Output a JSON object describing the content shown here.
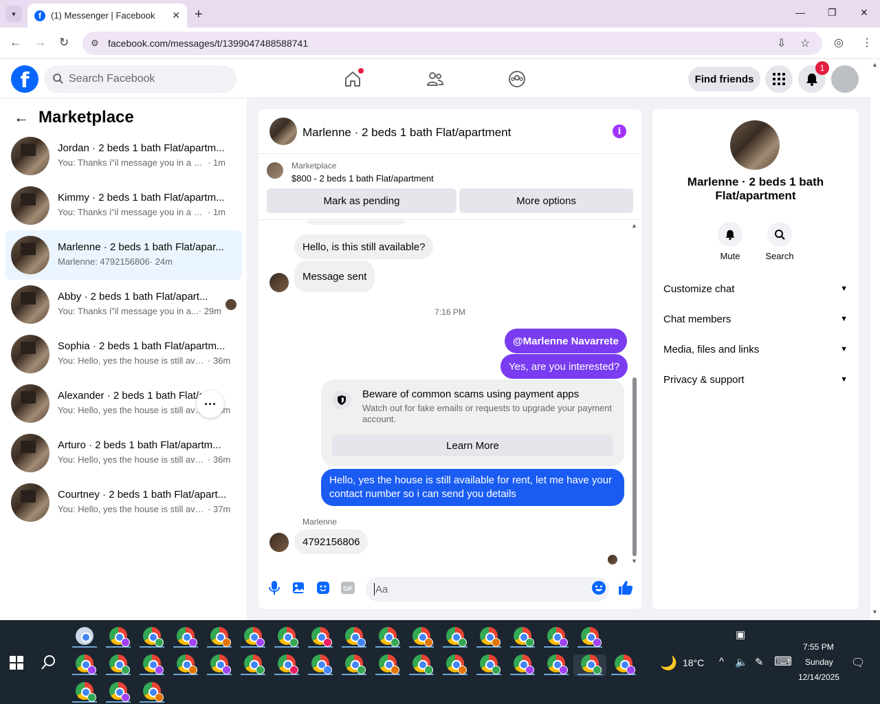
{
  "browser": {
    "tab_title": "(1) Messenger | Facebook",
    "url": "facebook.com/messages/t/1399047488588741"
  },
  "fb_header": {
    "search_placeholder": "Search Facebook",
    "find_friends": "Find friends",
    "notification_count": "1"
  },
  "sidebar": {
    "title": "Marketplace",
    "conversations": [
      {
        "name": "Jordan · 2 beds 1 bath Flat/apartm...",
        "preview": "You: Thanks i\"il message you in a mo...",
        "time": "· 1m",
        "active": false
      },
      {
        "name": "Kimmy · 2 beds 1 bath Flat/apartm...",
        "preview": "You: Thanks i\"il message you in a mo...",
        "time": "· 1m",
        "active": false
      },
      {
        "name": "Marlenne · 2 beds 1 bath Flat/apar...",
        "preview": "Marlenne: 4792156806",
        "time": "· 24m",
        "active": true
      },
      {
        "name": "Abby · 2 beds 1 bath Flat/apart...",
        "preview": "You: Thanks i\"il message you in a...",
        "time": "· 29m",
        "active": false
      },
      {
        "name": "Sophia · 2 beds 1 bath Flat/apartm...",
        "preview": "You: Hello, yes the house is still avail...",
        "time": "· 36m",
        "active": false
      },
      {
        "name": "Alexander · 2 beds 1 bath Flat/a...",
        "preview": "You: Hello, yes the house is still avail...",
        "time": "· 36m",
        "active": false
      },
      {
        "name": "Arturo · 2 beds 1 bath Flat/apartm...",
        "preview": "You: Hello, yes the house is still avail...",
        "time": "· 36m",
        "active": false
      },
      {
        "name": "Courtney · 2 beds 1 bath Flat/apart...",
        "preview": "You: Hello, yes the house is still avail...",
        "time": "· 37m",
        "active": false
      }
    ]
  },
  "chat": {
    "header_name": "Marlenne · 2 beds 1 bath Flat/apartment",
    "marketplace_label": "Marketplace",
    "listing": "$800 - 2 beds 1 bath Flat/apartment",
    "mark_pending": "Mark as pending",
    "more_options": "More options",
    "msg_still_available": "Hello, is this still available?",
    "msg_sent": "Message sent",
    "time_separator": "7:16 PM",
    "mention": "@Marlenne Navarrete",
    "msg_interested": "Yes, are you interested?",
    "scam_title": "Beware of common scams using payment apps",
    "scam_body": "Watch out for fake emails or requests to upgrade your payment account.",
    "learn_more": "Learn More",
    "msg_reply_1": "Hello, yes the house is still available for rent, let me have your",
    "msg_reply_2": "contact number so i can send you details",
    "sender": "Marlenne",
    "msg_number": "4792156806",
    "composer_placeholder": "Aa"
  },
  "right_panel": {
    "name_line1": "Marlenne · 2 beds 1 bath",
    "name_line2": "Flat/apartment",
    "mute": "Mute",
    "search": "Search",
    "rows": [
      "Customize chat",
      "Chat members",
      "Media, files and links",
      "Privacy & support"
    ]
  },
  "taskbar": {
    "temperature": "18°C",
    "time": "7:55 PM",
    "day": "Sunday",
    "date": "12/14/2025"
  },
  "colors": {
    "fb_blue": "#0866ff",
    "messenger_purple": "#7a3cf0",
    "messenger_blue": "#1a5cf2",
    "active_conv": "#ebf5ff"
  }
}
